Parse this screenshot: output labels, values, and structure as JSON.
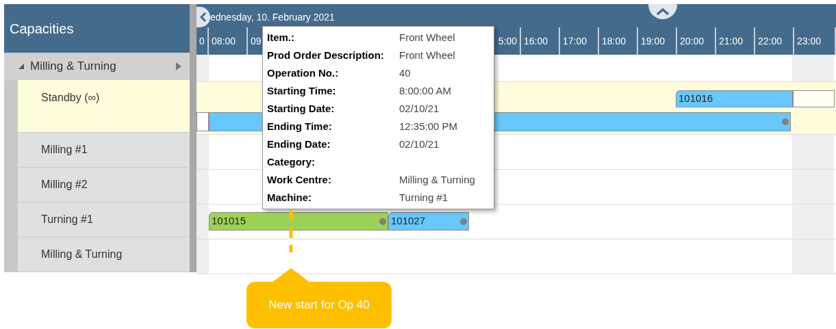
{
  "panel": {
    "title": "Capacities"
  },
  "timeline": {
    "date": "ednesday, 10. February 2021",
    "hours": [
      "0",
      "08:00",
      "09",
      "5:00",
      "16:00",
      "17:00",
      "18:00",
      "19:00",
      "20:00",
      "21:00",
      "22:00",
      "23:00"
    ]
  },
  "rows": [
    {
      "kind": "group",
      "label": "Milling & Turning",
      "expanded": true,
      "bars": []
    },
    {
      "kind": "resource",
      "label": "Standby (∞)",
      "highlighted": true,
      "bars": [
        {
          "label": "101016",
          "color": "#66c8fc",
          "end_dot": false
        },
        {
          "color": "#fffff5",
          "end_dot": false
        },
        {
          "color": "#ffffff",
          "end_dot": false
        },
        {
          "color": "#66c8fc",
          "end_dot": true
        }
      ]
    },
    {
      "kind": "resource",
      "label": "Milling #1",
      "highlighted": false,
      "bars": []
    },
    {
      "kind": "resource",
      "label": "Milling #2",
      "highlighted": false,
      "bars": []
    },
    {
      "kind": "resource",
      "label": "Turning #1",
      "highlighted": false,
      "bars": [
        {
          "label": "101015",
          "color": "#9ed257",
          "end_dot": true
        },
        {
          "label": "101027",
          "color": "#66c8fc",
          "end_dot": true
        }
      ]
    },
    {
      "kind": "resource",
      "label": "Milling & Turning",
      "highlighted": false,
      "bars": []
    }
  ],
  "tooltip": {
    "fields": [
      {
        "label": "Item.:",
        "value": "Front Wheel"
      },
      {
        "label": "Prod Order Description:",
        "value": "Front Wheel"
      },
      {
        "label": "Operation No.:",
        "value": "40"
      },
      {
        "label": "Starting Time:",
        "value": "8:00:00 AM"
      },
      {
        "label": "Starting Date:",
        "value": "02/10/21"
      },
      {
        "label": "Ending Time:",
        "value": "12:35:00 PM"
      },
      {
        "label": "Ending Date:",
        "value": "02/10/21"
      },
      {
        "label": "Category:"
      },
      {
        "label": "Work Centre:",
        "value": "Milling & Turning"
      },
      {
        "label": "Machine:",
        "value": "Turning #1"
      }
    ]
  },
  "callout": {
    "text": "New start for Op 40"
  }
}
